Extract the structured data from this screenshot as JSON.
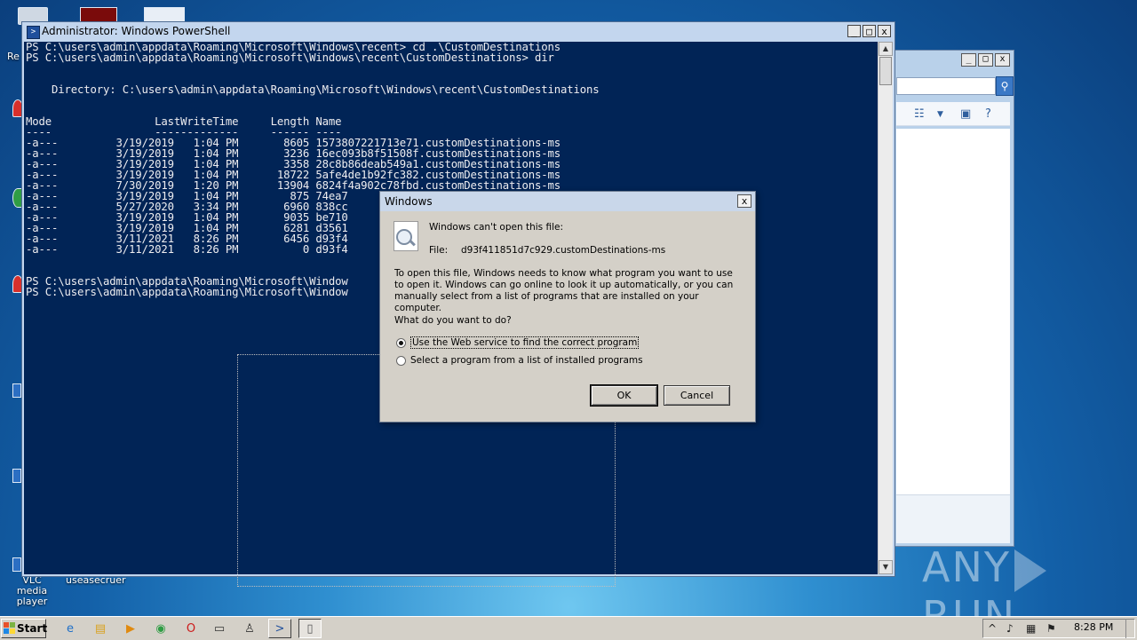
{
  "desktop": {
    "icons": [
      "Re",
      "VLC media player",
      "useasecruer"
    ]
  },
  "powershell": {
    "title": "Administrator: Windows PowerShell",
    "console_lines": [
      "PS C:\\users\\admin\\appdata\\Roaming\\Microsoft\\Windows\\recent> cd .\\CustomDestinations",
      "PS C:\\users\\admin\\appdata\\Roaming\\Microsoft\\Windows\\recent\\CustomDestinations> dir",
      "",
      "",
      "    Directory: C:\\users\\admin\\appdata\\Roaming\\Microsoft\\Windows\\recent\\CustomDestinations",
      "",
      "",
      "Mode                LastWriteTime     Length Name",
      "----                -------------     ------ ----",
      "-a---         3/19/2019   1:04 PM       8605 1573807221713e71.customDestinations-ms",
      "-a---         3/19/2019   1:04 PM       3236 16ec093b8f51508f.customDestinations-ms",
      "-a---         3/19/2019   1:04 PM       3358 28c8b86deab549a1.customDestinations-ms",
      "-a---         3/19/2019   1:04 PM      18722 5afe4de1b92fc382.customDestinations-ms",
      "-a---         7/30/2019   1:20 PM      13904 6824f4a902c78fbd.customDestinations-ms",
      "-a---         3/19/2019   1:04 PM        875 74ea7",
      "-a---         5/27/2020   3:34 PM       6960 838cc",
      "-a---         3/19/2019   1:04 PM       9035 be710",
      "-a---         3/19/2019   1:04 PM       6281 d3561",
      "-a---         3/11/2021   8:26 PM       6456 d93f4",
      "-a---         3/11/2021   8:26 PM          0 d93f4",
      "",
      "",
      "PS C:\\users\\admin\\appdata\\Roaming\\Microsoft\\Window                                          mDestinations-ms",
      "PS C:\\users\\admin\\appdata\\Roaming\\Microsoft\\Window"
    ]
  },
  "dialog": {
    "title": "Windows",
    "heading": "Windows can't open this file:",
    "file_label": "File:",
    "file_name": "d93f411851d7c929.customDestinations-ms",
    "description": "To open this file, Windows needs to know what program you want to use to open it. Windows can go online to look it up automatically, or you can manually select from a list of programs that are installed on your computer.",
    "question": "What do you want to do?",
    "option_web": "Use the Web service to find the correct program",
    "option_list": "Select a program from a list of installed programs",
    "ok_label": "OK",
    "cancel_label": "Cancel"
  },
  "watermark": {
    "left": "ANY",
    "right": "RUN"
  },
  "taskbar": {
    "start_label": "Start",
    "clock": "8:28 PM"
  },
  "colors": {
    "console_bg": "#012456",
    "console_fg": "#eeedf0",
    "dialog_bg": "#d4d0c8"
  }
}
